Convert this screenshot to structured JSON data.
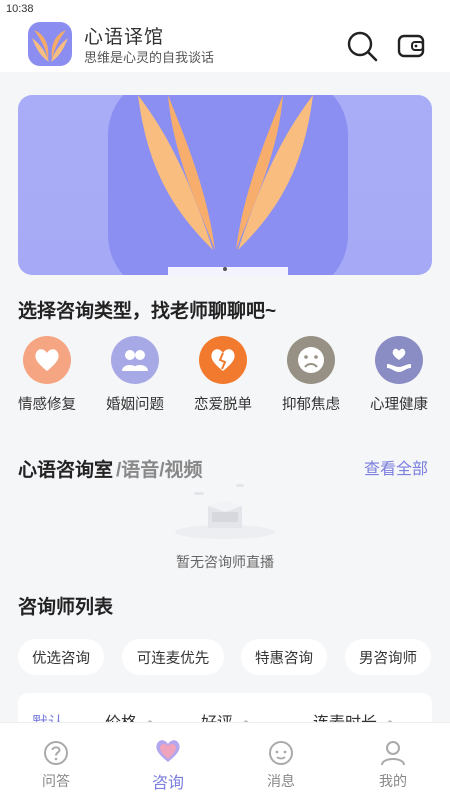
{
  "status_bar": {
    "time": "10:38"
  },
  "header": {
    "app_name": "心语译馆",
    "slogan": "思维是心灵的自我谈话",
    "icons": [
      "search-icon",
      "wallet-icon"
    ]
  },
  "categories": {
    "title": "选择咨询类型，找老师聊聊吧~",
    "items": [
      {
        "label": "情感修复",
        "icon": "heart-bubble-icon",
        "color": "#f6a582"
      },
      {
        "label": "婚姻问题",
        "icon": "couple-icon",
        "color": "#a7a9e6"
      },
      {
        "label": "恋爱脱单",
        "icon": "broken-heart-icon",
        "color": "#f27a2f"
      },
      {
        "label": "抑郁焦虑",
        "icon": "sad-face-icon",
        "color": "#979084"
      },
      {
        "label": "心理健康",
        "icon": "heart-hand-icon",
        "color": "#8a8cc4"
      }
    ]
  },
  "room": {
    "title": "心语咨询室",
    "subtitle": "/语音/视频",
    "view_all": "查看全部",
    "empty_text": "暂无咨询师直播"
  },
  "counselor_list": {
    "title": "咨询师列表",
    "filters": [
      "优选咨询",
      "可连麦优先",
      "特惠咨询",
      "男咨询师"
    ],
    "sort": [
      "默认",
      "价格",
      "好评",
      "连麦时长"
    ]
  },
  "tabbar": {
    "items": [
      {
        "label": "问答",
        "icon": "question-icon"
      },
      {
        "label": "咨询",
        "icon": "heart-chat-icon"
      },
      {
        "label": "消息",
        "icon": "message-icon"
      },
      {
        "label": "我的",
        "icon": "user-icon"
      }
    ],
    "active": "咨询"
  },
  "colors": {
    "accent": "#7b7fdd",
    "banner": "#a9adf7",
    "leaf": "#f9be7f"
  }
}
